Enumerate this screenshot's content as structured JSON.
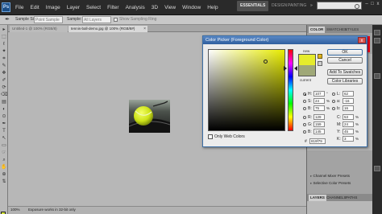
{
  "app": {
    "logo": "Ps",
    "menu": [
      "File",
      "Edit",
      "Image",
      "Layer",
      "Select",
      "Filter",
      "Analysis",
      "3D",
      "View",
      "Window",
      "Help"
    ],
    "workspaces": {
      "essentials": "ESSENTIALS",
      "design": "DESIGN",
      "painting": "PAINTING",
      "more": "»"
    },
    "window_controls": [
      "–",
      "□",
      "x"
    ]
  },
  "options": {
    "sample_size_label": "Sample Size:",
    "sample_size_value": "Point Sample",
    "sample_label": "Sample:",
    "sample_value": "All Layers",
    "show_ring_label": "Show Sampling Ring"
  },
  "tools": [
    "▸",
    "⬚",
    "ℓ",
    "✦",
    "⌗",
    "✎",
    "❖",
    "✐",
    "⟳",
    "⌫",
    "▤",
    "◐",
    "⊙",
    "✒",
    "T",
    "↖",
    "▭",
    "☞",
    "⌕",
    "✋",
    "⊕",
    "⇅"
  ],
  "colors": {
    "foreground": "#d3e33a",
    "new": "#e6ec2c",
    "current": "#9fa878",
    "accent": "#3b6ea5"
  },
  "documents": {
    "tabs": [
      {
        "label": "Untitled-1 @ 100% (RGB/8)",
        "active": false
      },
      {
        "label": "tennis-ball-demo.jpg @ 100% (RGB/8#)",
        "active": true
      }
    ]
  },
  "status": {
    "zoom": "100%",
    "text": "Exposure works in 32-bit only"
  },
  "panels": {
    "tabs": {
      "color": "COLOR",
      "swatches": "SWATCHES",
      "styles": "STYLES"
    },
    "presets": [
      "Channel Mixer Presets",
      "Selective Color Presets"
    ],
    "layers_tabs": {
      "layers": "LAYERS",
      "channels": "CHANNELS",
      "paths": "PATHS"
    }
  },
  "color_picker": {
    "title": "Color Picker (Foreground Color)",
    "close": "x",
    "new_label": "new",
    "current_label": "current",
    "buttons": {
      "ok": "OK",
      "cancel": "Cancel",
      "add": "Add To Swatches",
      "libraries": "Color Libraries"
    },
    "only_web": "Only Web Colors",
    "fields": {
      "H": {
        "value": "107",
        "unit": "°"
      },
      "S": {
        "value": "24",
        "unit": "%"
      },
      "B": {
        "value": "75",
        "unit": "%"
      },
      "R": {
        "value": "129",
        "unit": ""
      },
      "G": {
        "value": "159",
        "unit": ""
      },
      "Bl": {
        "value": "145",
        "unit": ""
      },
      "L": {
        "value": "62",
        "unit": ""
      },
      "a": {
        "value": "-16",
        "unit": ""
      },
      "b": {
        "value": "16",
        "unit": ""
      },
      "C": {
        "value": "53",
        "unit": "%"
      },
      "M": {
        "value": "24",
        "unit": "%"
      },
      "Y": {
        "value": "45",
        "unit": "%"
      },
      "K": {
        "value": "3",
        "unit": "%"
      }
    },
    "hex": "819f79"
  }
}
